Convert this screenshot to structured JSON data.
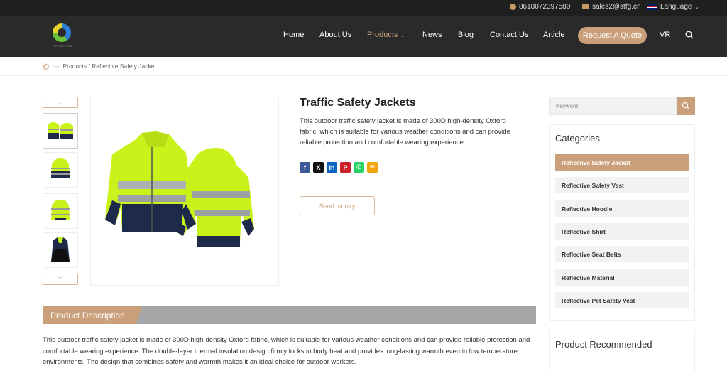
{
  "topbar": {
    "phone": "8618072397580",
    "email": "sales2@stfg.cn",
    "language": "Language"
  },
  "nav": {
    "items": [
      {
        "label": "Home"
      },
      {
        "label": "About Us"
      },
      {
        "label": "Products"
      },
      {
        "label": "News"
      },
      {
        "label": "Blog"
      },
      {
        "label": "Contact Us"
      },
      {
        "label": "Article"
      }
    ],
    "quote_label": "Request A Quote",
    "vr_label": "VR",
    "active_color": "#c9a57a"
  },
  "breadcrumb": {
    "separator": "—",
    "path": "Products / Reflective Safety Jacket"
  },
  "product": {
    "title": "Traffic Safety Jackets",
    "summary": "This outdoor traffic safety jacket is made of 300D high-density Oxford fabric, which is suitable for various weather conditions and can provide reliable protection and comfortable wearing experience.",
    "share_icons": [
      "facebook-icon",
      "x-icon",
      "linkedin-icon",
      "pinterest-icon",
      "whatsapp-icon",
      "email-icon"
    ],
    "inquiry_label": "Send Inquiry"
  },
  "description": {
    "tab_label": "Product Description",
    "text": "This outdoor traffic safety jacket is made of 300D high-density Oxford fabric, which is suitable for various weather conditions and can provide reliable protection and comfortable wearing experience. The double-layer thermal insulation design firmly locks in body heat and provides long-lasting warmth even in low temperature environments. The design that combines safety and warmth makes it an ideal choice for outdoor workers."
  },
  "sidebar": {
    "search_placeholder": "Keyword",
    "categories_title": "Categories",
    "categories": [
      {
        "label": "Reflective Safety Jacket"
      },
      {
        "label": "Reflective Safety Vest"
      },
      {
        "label": "Reflective Hoodie"
      },
      {
        "label": "Reflective Shirt"
      },
      {
        "label": "Reflective Seat Belts"
      },
      {
        "label": "Reflective Material"
      },
      {
        "label": "Reflective Pet Safety Vest"
      }
    ],
    "recommended_title": "Product Recommended"
  },
  "colors": {
    "accent": "#c9a07a",
    "hi_vis": "#c9f21a",
    "navy": "#1e2a4a",
    "header_bg": "#2a2a2a"
  }
}
